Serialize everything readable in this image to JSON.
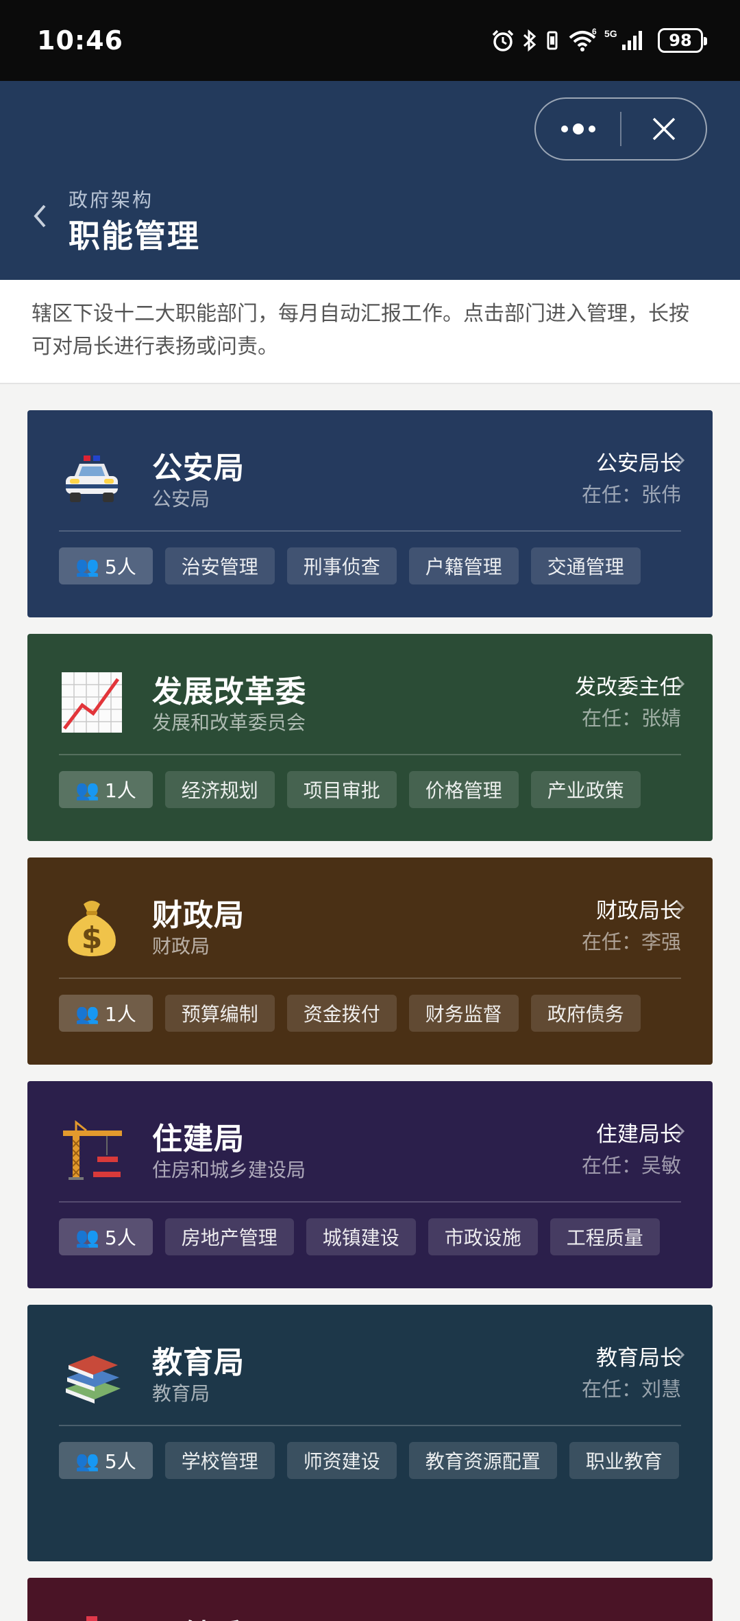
{
  "status_bar": {
    "time": "10:46",
    "battery": "98"
  },
  "header": {
    "subtitle": "政府架构",
    "title": "职能管理"
  },
  "description": "辖区下设十二大职能部门，每月自动汇报工作。点击部门进入管理，长按可对局长进行表扬或问责。",
  "departments": [
    {
      "name": "公安局",
      "full_name": "公安局",
      "role": "公安局长",
      "incumbent": "在任：张伟",
      "count": "5人",
      "tags": [
        "治安管理",
        "刑事侦查",
        "户籍管理",
        "交通管理"
      ],
      "color": "#253a5e",
      "icon": "police-car-icon"
    },
    {
      "name": "发展改革委",
      "full_name": "发展和改革委员会",
      "role": "发改委主任",
      "incumbent": "在任：张婧",
      "count": "1人",
      "tags": [
        "经济规划",
        "项目审批",
        "价格管理",
        "产业政策"
      ],
      "color": "#2b4c36",
      "icon": "chart-increasing-icon"
    },
    {
      "name": "财政局",
      "full_name": "财政局",
      "role": "财政局长",
      "incumbent": "在任：李强",
      "count": "1人",
      "tags": [
        "预算编制",
        "资金拨付",
        "财务监督",
        "政府债务"
      ],
      "color": "#4a3015",
      "icon": "money-bag-icon"
    },
    {
      "name": "住建局",
      "full_name": "住房和城乡建设局",
      "role": "住建局长",
      "incumbent": "在任：吴敏",
      "count": "5人",
      "tags": [
        "房地产管理",
        "城镇建设",
        "市政设施",
        "工程质量"
      ],
      "color": "#2b1f4b",
      "icon": "construction-crane-icon"
    },
    {
      "name": "教育局",
      "full_name": "教育局",
      "role": "教育局长",
      "incumbent": "在任：刘慧",
      "count": "5人",
      "tags": [
        "学校管理",
        "师资建设",
        "教育资源配置",
        "职业教育"
      ],
      "color": "#1d3749",
      "icon": "books-icon"
    },
    {
      "name": "卫健委",
      "color": "#4a1426",
      "icon": "hospital-icon"
    }
  ]
}
